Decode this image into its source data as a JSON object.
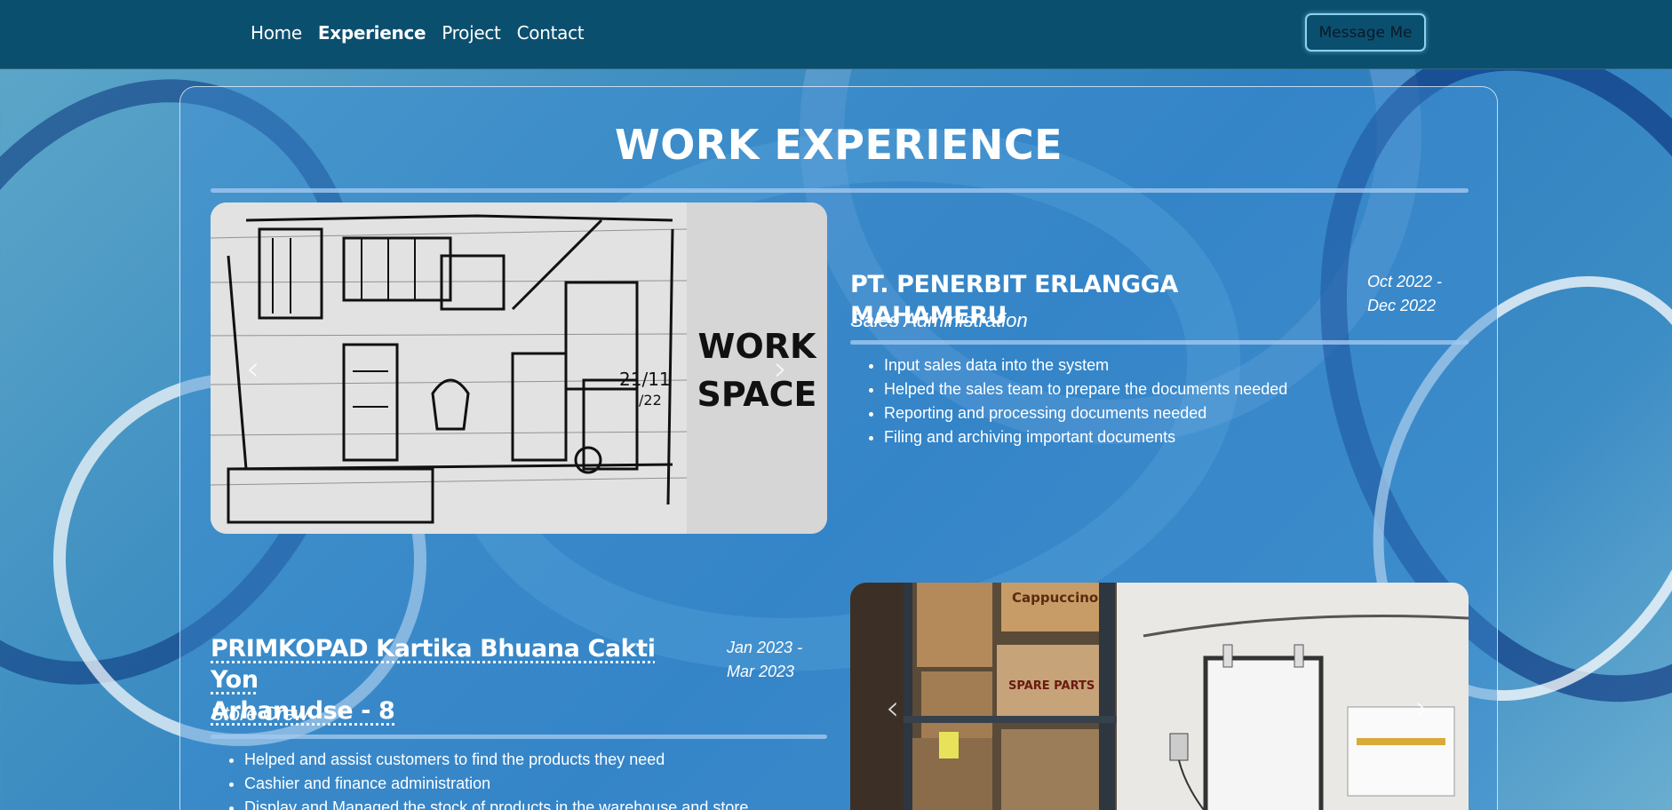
{
  "nav": {
    "links": [
      {
        "label": "Home"
      },
      {
        "label": "Experience"
      },
      {
        "label": "Project"
      },
      {
        "label": "Contact"
      }
    ],
    "message_button": "Message Me"
  },
  "section": {
    "title": "WORK EXPERIENCE"
  },
  "experiences": [
    {
      "company": "PT. PENERBIT ERLANGGA MAHAMERU",
      "date_line1": "Oct 2022 -",
      "date_line2": "Dec 2022",
      "role": "Sales Administration",
      "duties": [
        "Input sales data into the system",
        "Helped the sales team to prepare the documents needed",
        "Reporting and processing documents needed",
        "Filing and archiving important documents"
      ],
      "image_text_line1": "WORK",
      "image_text_line2": "SPACE",
      "image_date": "21/11",
      "image_date2": "/22"
    },
    {
      "company_line1": "PRIMKOPAD Kartika Bhuana Cakti Yon",
      "company_line2": "Arhanudse - 8",
      "date_line1": "Jan 2023 -",
      "date_line2": "Mar 2023",
      "role": "Store Crew",
      "duties": [
        "Helped and assist customers to find the products they need",
        "Cashier and finance administration",
        "Display and Managed the stock of products in the warehouse and store"
      ],
      "image_box_labels": [
        "Cappuccino",
        "SPARE PARTS"
      ]
    }
  ],
  "carousel": {
    "prev": "‹",
    "next": "›"
  }
}
